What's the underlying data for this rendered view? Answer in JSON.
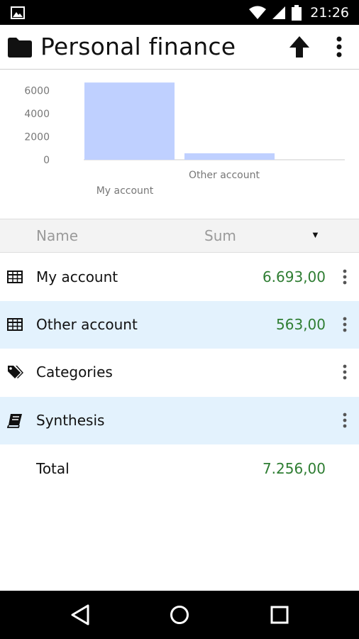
{
  "status_bar": {
    "time": "21:26",
    "icons": [
      "image-icon",
      "wifi-icon",
      "signal-icon",
      "battery-icon"
    ]
  },
  "app_bar": {
    "title": "Personal finance",
    "icons": [
      "folder-icon",
      "arrow-up-icon",
      "overflow-menu-icon"
    ]
  },
  "chart_data": {
    "type": "bar",
    "categories": [
      "My account",
      "Other account"
    ],
    "values": [
      6693,
      563
    ],
    "yticks": [
      "6000",
      "4000",
      "2000",
      "0"
    ],
    "ylim": [
      0,
      7000
    ],
    "color": "#bfd0ff"
  },
  "table": {
    "header": {
      "name": "Name",
      "sum": "Sum",
      "sort_indicator": "▼"
    },
    "rows": [
      {
        "icon": "table-icon",
        "label": "My account",
        "value": "6.693,00"
      },
      {
        "icon": "table-icon",
        "label": "Other account",
        "value": "563,00"
      },
      {
        "icon": "tags-icon",
        "label": "Categories",
        "value": ""
      },
      {
        "icon": "book-icon",
        "label": "Synthesis",
        "value": ""
      }
    ],
    "total": {
      "label": "Total",
      "value": "7.256,00"
    }
  },
  "colors": {
    "value_green": "#2e7d32",
    "row_highlight": "#e3f2fd",
    "header_bg": "#f3f3f3"
  },
  "nav_bar": {
    "icons": [
      "back-icon",
      "home-icon",
      "recent-apps-icon"
    ]
  }
}
